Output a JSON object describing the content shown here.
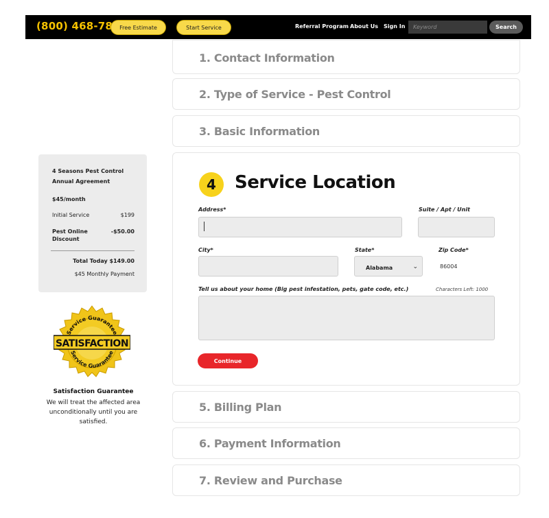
{
  "header": {
    "phone": "(800) 468-7859",
    "free_estimate": "Free Estimate",
    "start_service": "Start Service",
    "links": [
      "Referral Program",
      "About Us",
      "Sign In"
    ],
    "search_placeholder": "Keyword",
    "search_button": "Search"
  },
  "steps": {
    "s1": "1. Contact Information",
    "s2": "2. Type of Service - Pest Control",
    "s3": "3. Basic Information",
    "s5": "5. Billing Plan",
    "s6": "6. Payment Information",
    "s7": "7. Review and Purchase"
  },
  "active_step": {
    "number": "4",
    "title": "Service Location",
    "address_label": "Address*",
    "suite_label": "Suite / Apt / Unit",
    "city_label": "City*",
    "state_label": "State*",
    "state_value": "Alabama",
    "zip_label": "Zip Code*",
    "zip_value": "86004",
    "notes_label": "Tell us about your home (Big pest infestation, pets, gate code, etc.)",
    "chars_left": "Characters Left: 1000",
    "continue_label": "Continue"
  },
  "summary": {
    "plan_line1": "4 Seasons Pest Control",
    "plan_line2": "Annual Agreement",
    "price": "$45/month",
    "initial_label": "Initial Service",
    "initial_value": "$199",
    "discount_label_1": "Pest Online",
    "discount_label_2": "Discount",
    "discount_value": "-$50.00",
    "total_today": "Total Today $149.00",
    "monthly": "$45 Monthly Payment"
  },
  "guarantee": {
    "seal_top": "Service Guarantee",
    "seal_main": "SATISFACTION",
    "seal_bottom": "Service Guarantee",
    "title": "Satisfaction Guarantee",
    "text": "We will treat the affected area unconditionally until you are satisfied."
  },
  "colors": {
    "accent_yellow": "#f7d21c",
    "continue_red": "#e8262a",
    "topbar": "#000000"
  }
}
